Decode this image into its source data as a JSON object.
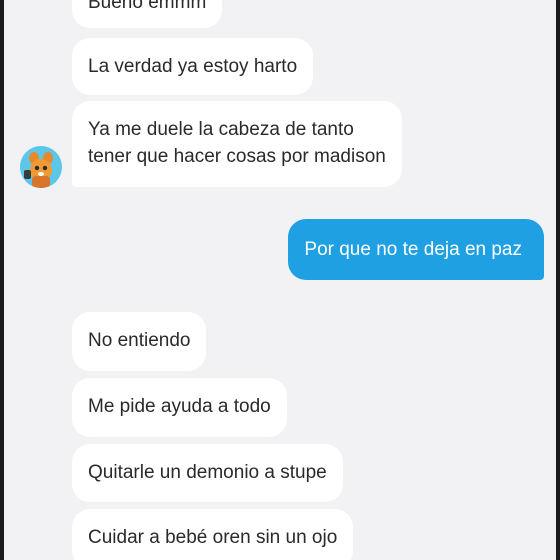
{
  "conversation": {
    "messages": [
      {
        "side": "in",
        "text": "Bueno emmm"
      },
      {
        "side": "in",
        "text": "La verdad ya estoy harto"
      },
      {
        "side": "in",
        "lines": [
          "Ya me duele la cabeza de tanto",
          "tener que hacer cosas por madison"
        ]
      },
      {
        "side": "out",
        "text": "Por que no te deja en paz"
      },
      {
        "side": "in",
        "text": "No entiendo"
      },
      {
        "side": "in",
        "text": "Me pide ayuda a todo"
      },
      {
        "side": "in",
        "text": "Quitarle un demonio a stupe"
      },
      {
        "side": "in",
        "text": "Cuidar a bebé oren sin un ojo"
      }
    ]
  },
  "colors": {
    "background": "#f2f2f4",
    "incoming_bubble": "#ffffff",
    "outgoing_bubble": "#1ea0e3"
  },
  "icons": {
    "avatar": "cartoon-character-avatar"
  }
}
